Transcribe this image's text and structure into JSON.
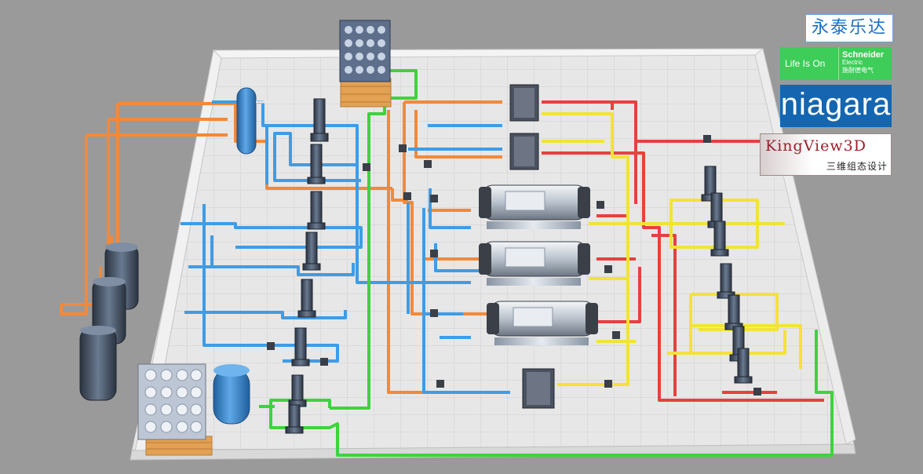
{
  "logos": {
    "yongtai": {
      "text": "永泰乐达"
    },
    "schneider": {
      "tagline": "Life Is On",
      "brand": "Schneider",
      "sub": "Electric",
      "cn": "施耐德电气"
    },
    "niagara": {
      "text": "niagara"
    },
    "kingview": {
      "title": "KingView3D",
      "subtitle": "三维组态设计"
    }
  },
  "colors": {
    "background": "#9a9a9a",
    "floor": "#e6e6e6",
    "wall": "#f2f2f2",
    "pipe_blue": "#3f9ce6",
    "pipe_orange": "#f2893a",
    "pipe_red": "#e6413f",
    "pipe_yellow": "#f3e238",
    "pipe_green": "#3fd23f",
    "equipment_dark": "#3a3f48",
    "tank_blue": "#2e7fc8"
  },
  "equipment": [
    "water-tank-top",
    "expansion-tank",
    "pressure-tanks",
    "water-tank-bottom",
    "blue-pressure-vessel",
    "plate-heat-exchanger",
    "chiller-units",
    "pumps"
  ]
}
